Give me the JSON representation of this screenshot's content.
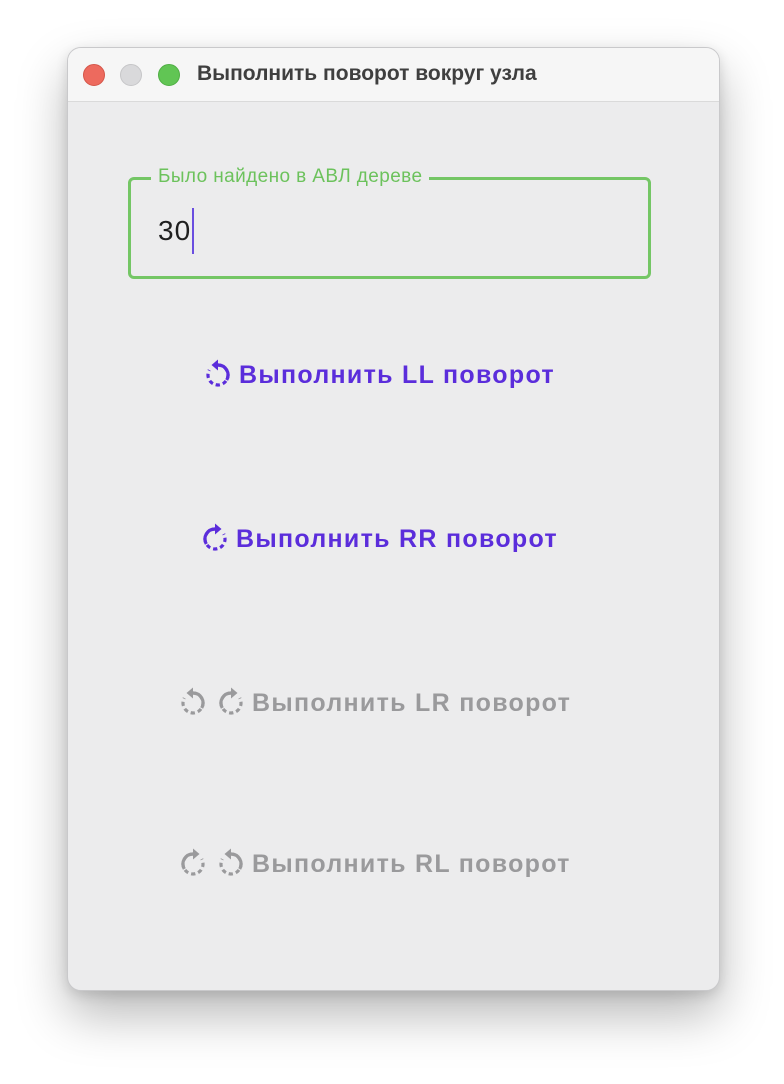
{
  "window": {
    "title": "Выполнить поворот вокруг узла"
  },
  "search_field": {
    "label": "Было найдено в АВЛ дереве",
    "value": "30"
  },
  "actions": [
    {
      "label": "Выполнить LL поворот",
      "icons": [
        "rotate-left-icon"
      ],
      "enabled": true
    },
    {
      "label": "Выполнить RR поворот",
      "icons": [
        "rotate-right-icon"
      ],
      "enabled": true
    },
    {
      "label": "Выполнить LR поворот",
      "icons": [
        "rotate-left-icon",
        "rotate-right-icon"
      ],
      "enabled": false
    },
    {
      "label": "Выполнить RL поворот",
      "icons": [
        "rotate-right-icon",
        "rotate-left-icon"
      ],
      "enabled": false
    }
  ],
  "colors": {
    "accent": "#5b2ddb",
    "field_border": "#74c665",
    "disabled": "#9a9a9c"
  }
}
